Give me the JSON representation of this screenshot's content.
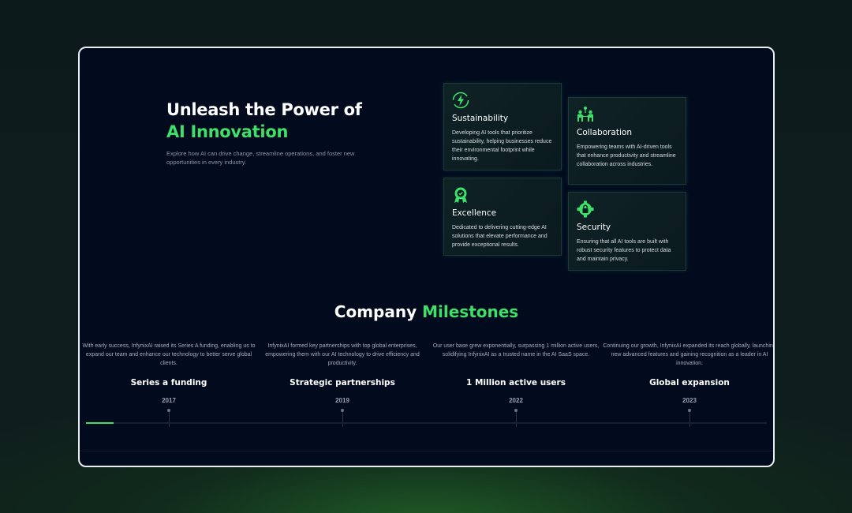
{
  "hero": {
    "title_line1": "Unleash the Power of",
    "title_line2": "AI Innovation",
    "subtitle": "Explore how AI can drive change, streamline operations, and foster new opportunities in every industry."
  },
  "features": [
    {
      "icon": "lightning-cycle-icon",
      "title": "Sustainability",
      "text": "Developing AI tools that prioritize sustainability, helping businesses reduce their environmental footprint while innovating."
    },
    {
      "icon": "team-collaboration-icon",
      "title": "Collaboration",
      "text": "Empowering teams with AI-driven tools that enhance productivity and streamline collaboration across industries."
    },
    {
      "icon": "award-badge-icon",
      "title": "Excellence",
      "text": "Dedicated to delivering cutting-edge AI solutions that elevate performance and provide exceptional results."
    },
    {
      "icon": "shield-lock-icon",
      "title": "Security",
      "text": "Ensuring that all AI tools are built with robust security features to protect data and maintain privacy."
    }
  ],
  "milestones": {
    "title_part1": "Company",
    "title_part2": "Milestones",
    "progress_percent": 4,
    "items": [
      {
        "text": "With early success, InfynixAI raised its Series A funding, enabling us to expand our team and enhance our technology to better serve global clients.",
        "title": "Series a funding",
        "year": "2017"
      },
      {
        "text": "InfynixAI formed key partnerships with top global enterprises, empowering them with our AI technology to drive efficiency and productivity.",
        "title": "Strategic partnerships",
        "year": "2019"
      },
      {
        "text": "Our user base grew exponentially, surpassing 1 million active users, solidifying InfynixAI as a trusted name in the AI SaaS space.",
        "title": "1 Million active users",
        "year": "2022"
      },
      {
        "text": "Continuing our growth, InfynixAI expanded its reach globally, launching new advanced features and gaining recognition as a leader in AI innovation.",
        "title": "Global expansion",
        "year": "2023"
      }
    ]
  },
  "colors": {
    "accent": "#3ee06a",
    "background": "#020a1e"
  }
}
